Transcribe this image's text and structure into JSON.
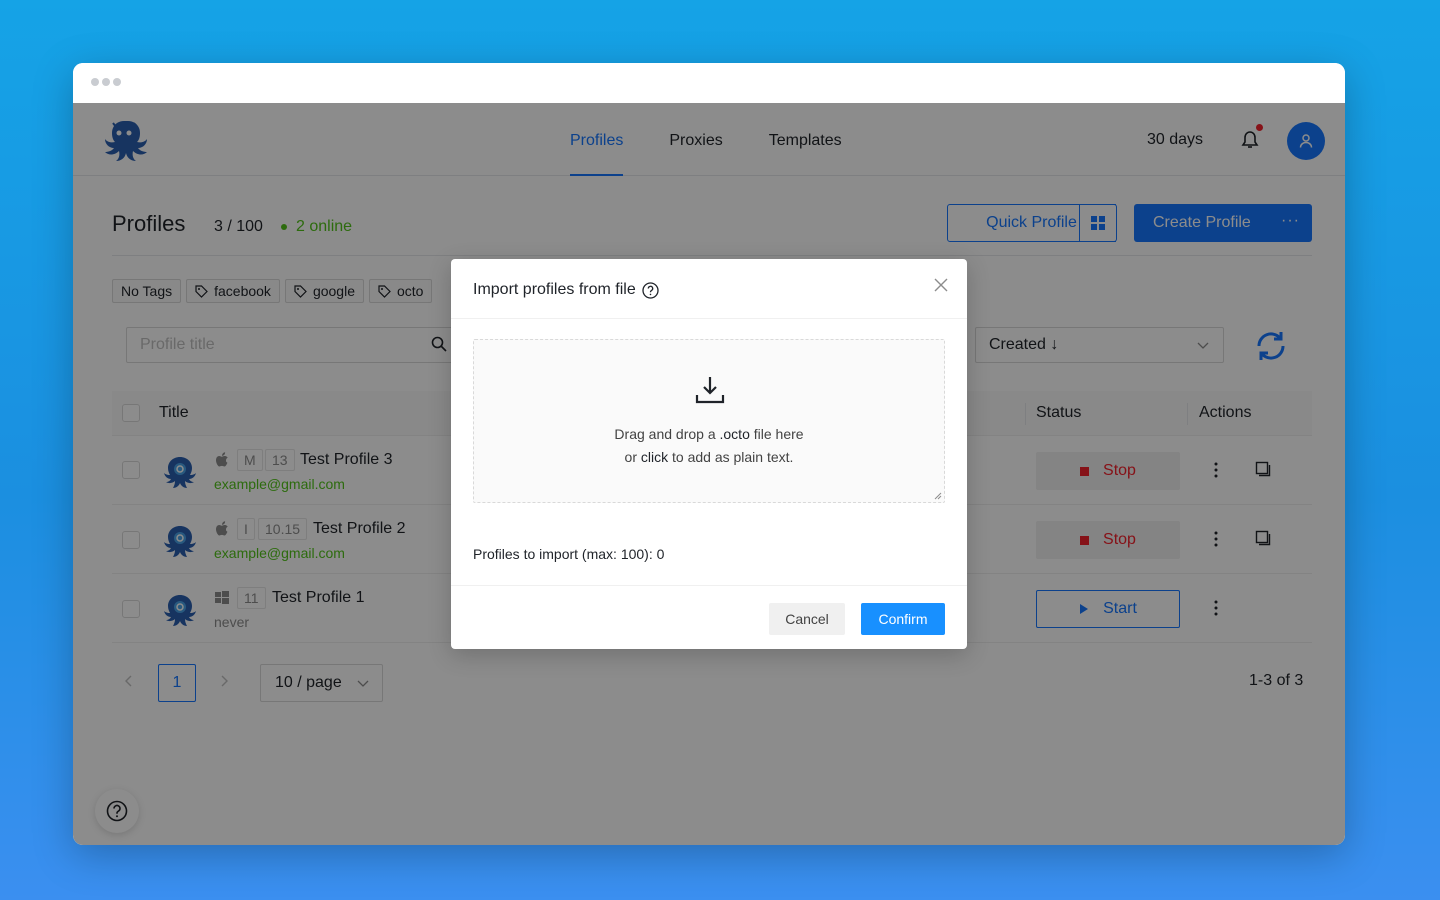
{
  "colors": {
    "accent": "#1677ff",
    "online": "#52c41a",
    "stop": "#f5222d"
  },
  "nav": {
    "items": [
      "Profiles",
      "Proxies",
      "Templates"
    ],
    "active": "Profiles"
  },
  "header": {
    "plan_days": "30 days"
  },
  "page": {
    "title": "Profiles",
    "count": "3 / 100",
    "online": "2 online"
  },
  "toolbar": {
    "quick_profile": "Quick Profile",
    "create_profile": "Create Profile",
    "more": "···"
  },
  "tags": [
    "No Tags",
    "facebook",
    "google",
    "octo"
  ],
  "search": {
    "placeholder": "Profile title"
  },
  "sort": {
    "value": "Created ↓"
  },
  "table": {
    "headers": {
      "title": "Title",
      "status": "Status",
      "actions": "Actions"
    },
    "rows": [
      {
        "os": "apple-icon",
        "chip1": "M",
        "chip2": "13",
        "title": "Test Profile 3",
        "sub": "example@gmail.com",
        "status": "Stop"
      },
      {
        "os": "apple-icon",
        "chip1": "I",
        "chip2": "10.15",
        "title": "Test Profile 2",
        "sub": "example@gmail.com",
        "status": "Stop"
      },
      {
        "os": "windows-icon",
        "chip1": "11",
        "title": "Test Profile 1",
        "sub": "never",
        "status": "Start"
      }
    ]
  },
  "pagination": {
    "page": "1",
    "page_size": "10 / page",
    "range": "1-3 of 3"
  },
  "modal": {
    "title": "Import profiles from file",
    "drop_line1_a": "Drag and drop a ",
    "drop_line1_b": ".octo",
    "drop_line1_c": " file here",
    "drop_line2_a": "or ",
    "drop_line2_b": "click",
    "drop_line2_c": " to add as plain text.",
    "import_count": "Profiles to import (max: 100): 0",
    "cancel": "Cancel",
    "confirm": "Confirm"
  }
}
